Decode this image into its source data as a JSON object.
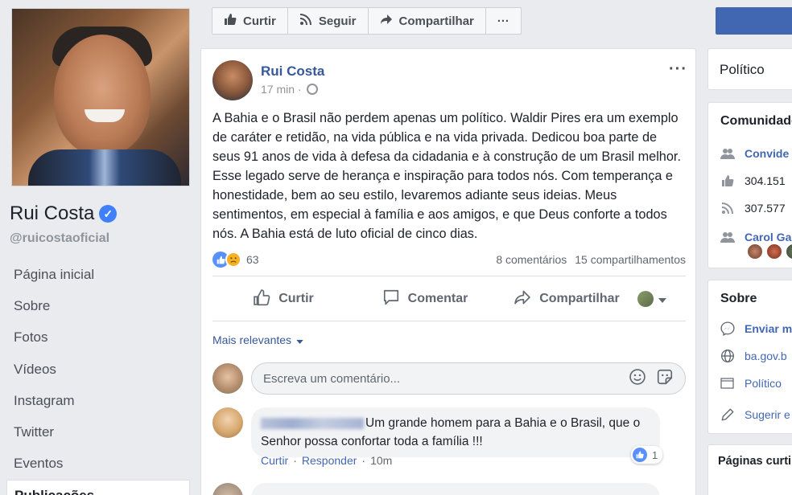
{
  "left_column": {
    "page_name": "Rui Costa",
    "verified_mark": "✓",
    "handle": "@ruicostaoficial",
    "nav": [
      {
        "label": "Página inicial"
      },
      {
        "label": "Sobre"
      },
      {
        "label": "Fotos"
      },
      {
        "label": "Vídeos"
      },
      {
        "label": "Instagram"
      },
      {
        "label": "Twitter"
      },
      {
        "label": "Eventos"
      },
      {
        "label": "Publicações"
      }
    ]
  },
  "action_bar": {
    "like_label": "Curtir",
    "follow_label": "Seguir",
    "share_label": "Compartilhar",
    "more_label": "···"
  },
  "post": {
    "author": "Rui Costa",
    "time": "17 min ·",
    "more": "···",
    "text": "A Bahia e o Brasil não perdem apenas um político. Waldir Pires era um exemplo de caráter e retidão, na vida pública e na vida privada. Dedicou boa parte de seus 91 anos de vida à defesa da cidadania e à construção de um Brasil melhor. Esse legado serve de herança e inspiração para todos nós. Com temperança e honestidade, bem ao seu estilo, levaremos adiante seus ideias. Meus sentimentos, em especial à família e aos amigos, e que Deus conforte a todos nós. A Bahia está de luto oficial de cinco dias.",
    "reactions_count": "63",
    "comments_count": "8 comentários",
    "shares_count": "15 compartilhamentos",
    "actions": {
      "like": "Curtir",
      "comment": "Comentar",
      "share": "Compartilhar"
    },
    "sort_label": "Mais relevantes",
    "comment_placeholder": "Escreva um comentário...",
    "comments": [
      {
        "text": "Um grande homem para a Bahia e o Brasil, que o Senhor possa confortar toda a família !!!",
        "like_link": "Curtir",
        "reply_link": "Responder",
        "time": "10m",
        "likes": "1"
      }
    ]
  },
  "right_column": {
    "category": "Político",
    "community_title": "Comunidade",
    "community_rows": [
      {
        "text": "Convide"
      },
      {
        "text": "304.151"
      },
      {
        "text": "307.577"
      },
      {
        "text": "Carol Ga"
      }
    ],
    "about_title": "Sobre",
    "about_rows": [
      {
        "text": "Enviar m"
      },
      {
        "text": "ba.gov.b"
      },
      {
        "text": "Político"
      },
      {
        "text": "Sugerir e"
      }
    ],
    "pages_title": "Páginas curti"
  }
}
